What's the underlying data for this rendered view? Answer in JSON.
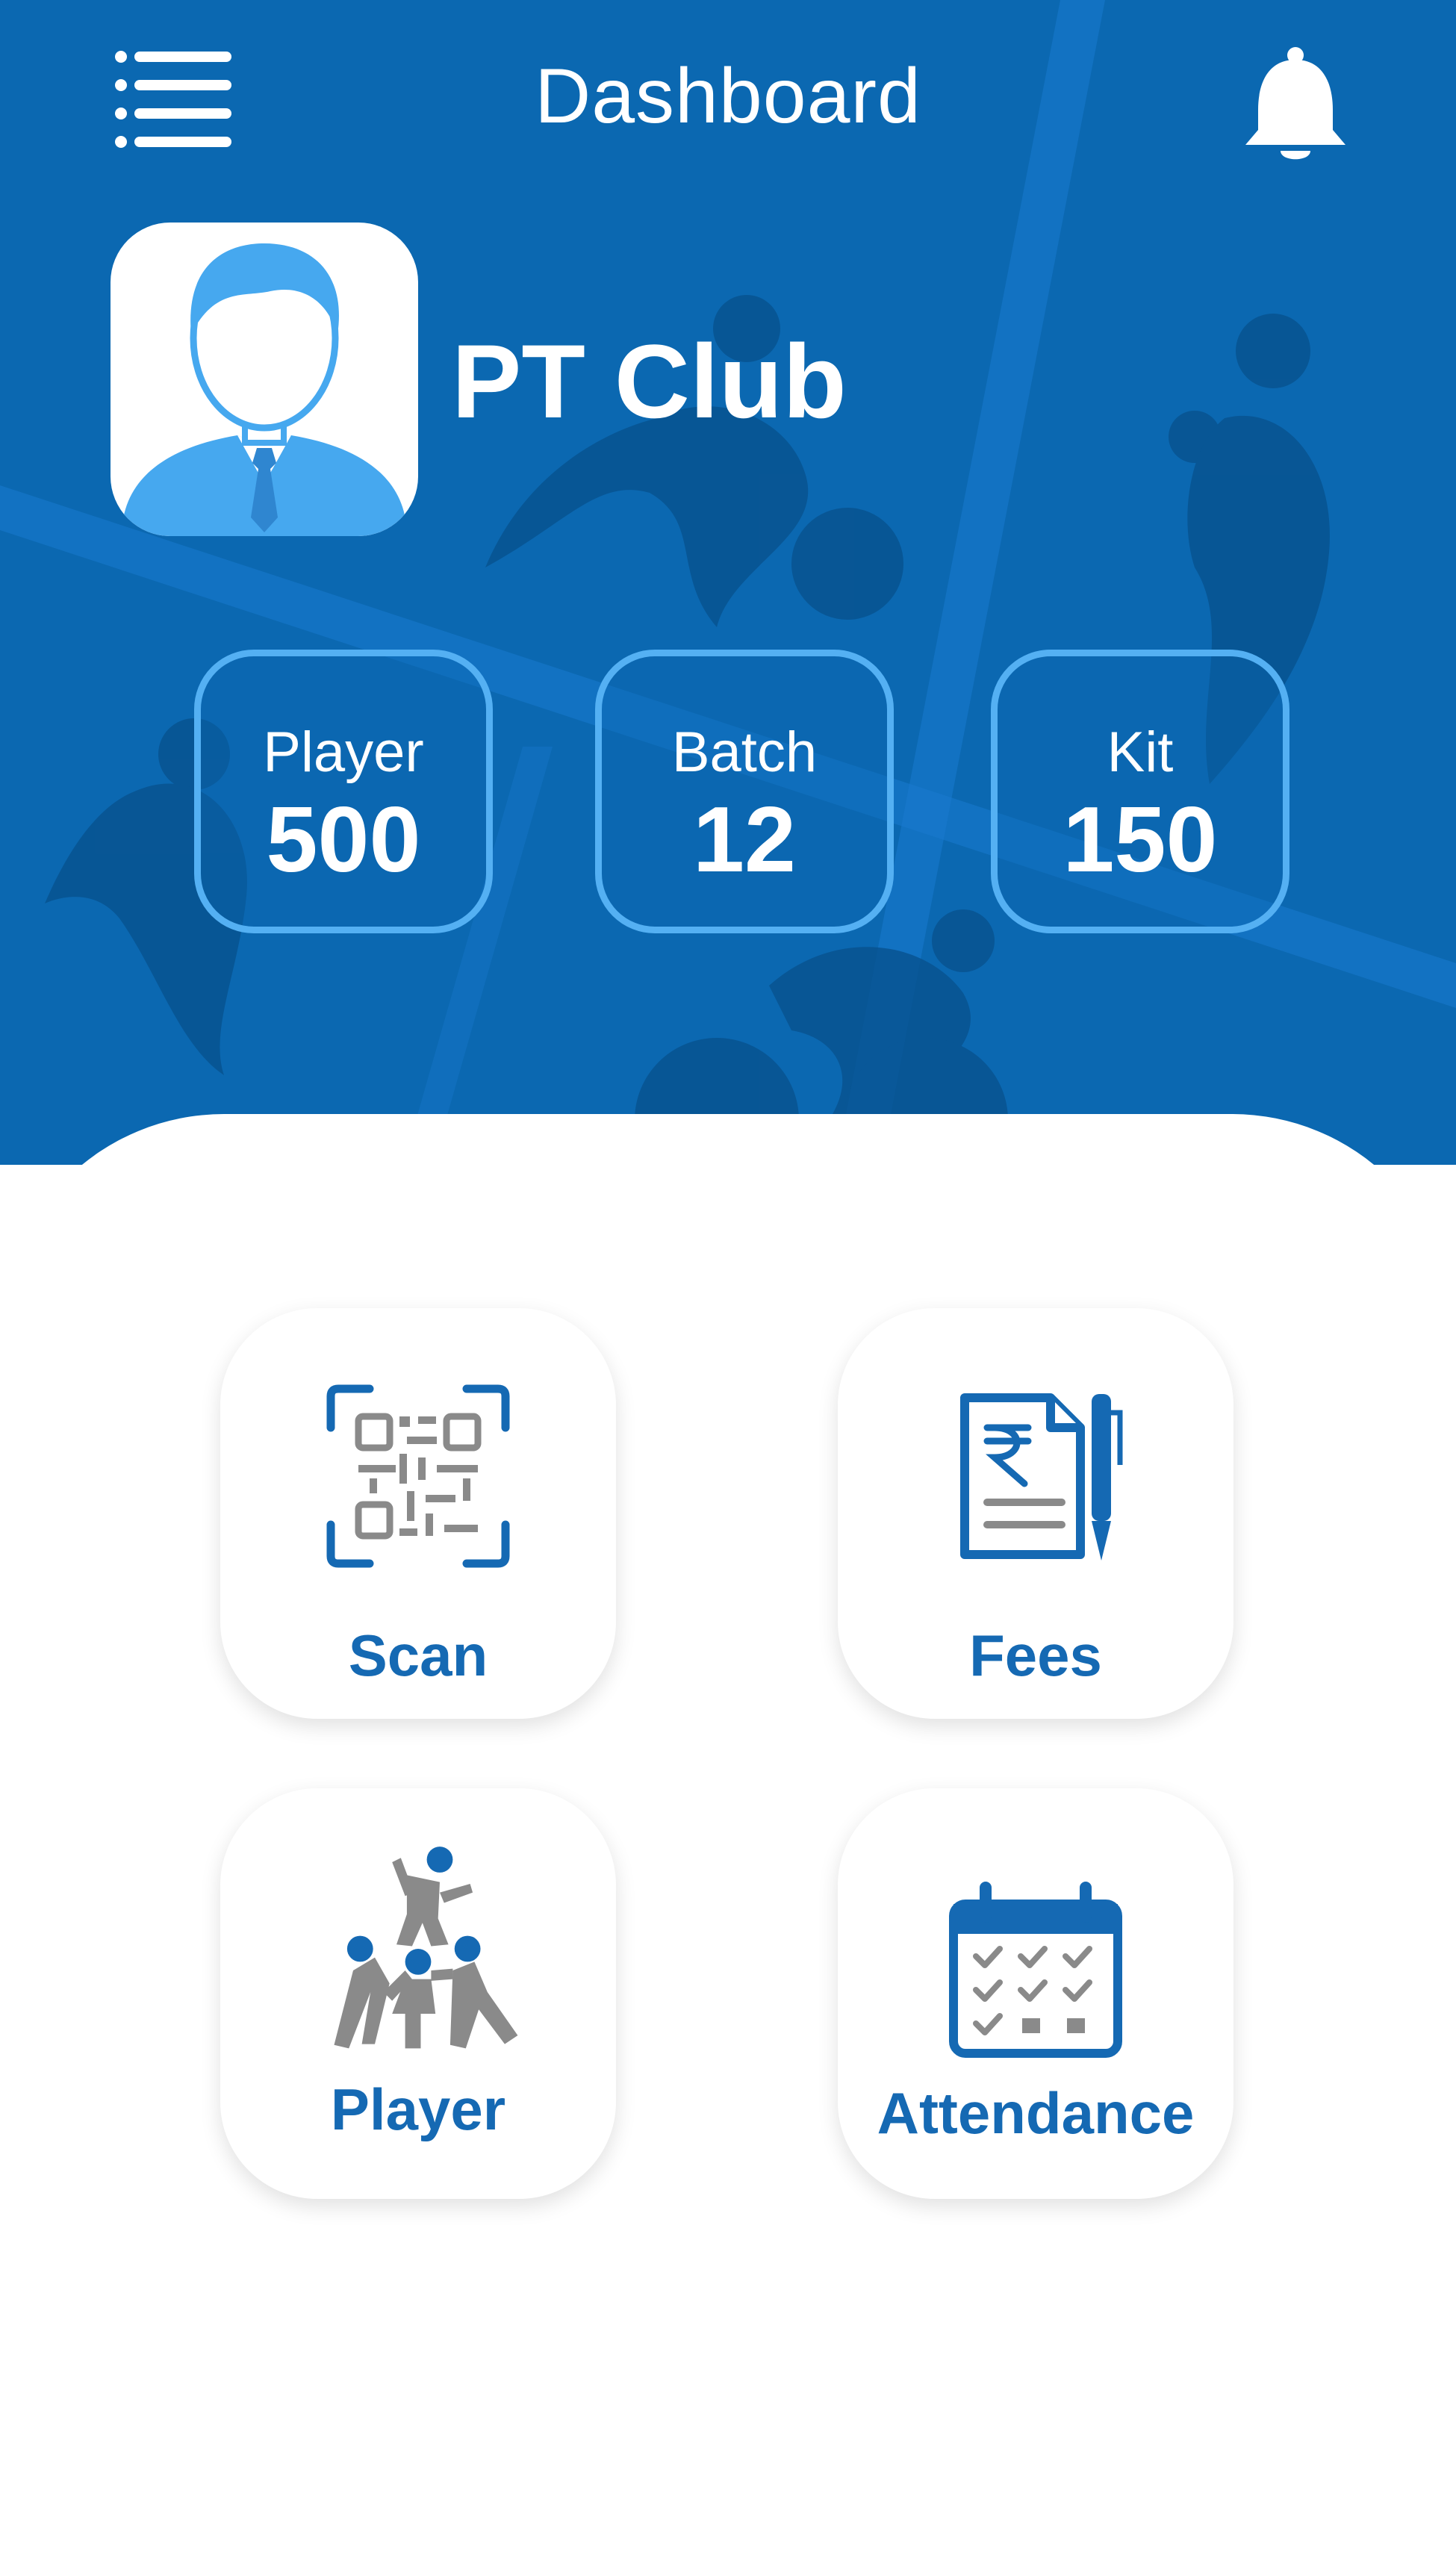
{
  "header": {
    "title": "Dashboard",
    "menu_icon": "menu-icon",
    "notification_icon": "bell-icon",
    "background_color": "#0b68b1"
  },
  "profile": {
    "name": "PT Club",
    "avatar_icon": "user-avatar-icon"
  },
  "stats": [
    {
      "label": "Player",
      "value": "500"
    },
    {
      "label": "Batch",
      "value": "12"
    },
    {
      "label": "Kit",
      "value": "150"
    }
  ],
  "actions": [
    {
      "label": "Scan",
      "icon": "qr-scan-icon"
    },
    {
      "label": "Fees",
      "icon": "fees-receipt-icon"
    },
    {
      "label": "Player",
      "icon": "players-team-icon"
    },
    {
      "label": "Attendance",
      "icon": "calendar-icon"
    }
  ],
  "colors": {
    "accent": "#1569b3",
    "stat_border": "#54b0f3",
    "icon_gray": "#8a8a8a"
  }
}
